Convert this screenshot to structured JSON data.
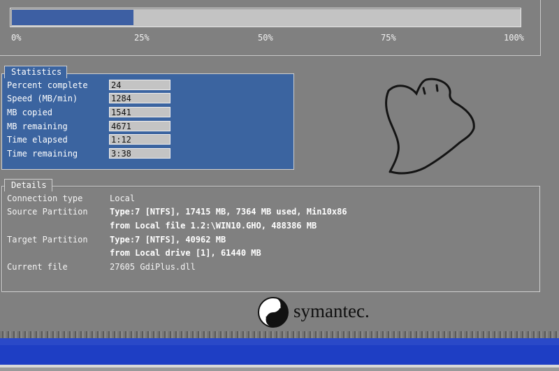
{
  "progress": {
    "fraction": 0.24,
    "ticks": [
      "0%",
      "25%",
      "50%",
      "75%",
      "100%"
    ]
  },
  "statistics": {
    "title": "Statistics",
    "rows": [
      {
        "label": "Percent complete",
        "value": "24"
      },
      {
        "label": "Speed (MB/min)",
        "value": "1284"
      },
      {
        "label": "MB copied",
        "value": "1541"
      },
      {
        "label": "MB remaining",
        "value": "4671"
      },
      {
        "label": "Time elapsed",
        "value": "1:12"
      },
      {
        "label": "Time remaining",
        "value": "3:38"
      }
    ]
  },
  "details": {
    "title": "Details",
    "connection_type_label": "Connection type",
    "connection_type_value": "Local",
    "source_partition_label": "Source Partition",
    "source_partition_line1": "Type:7 [NTFS], 17415 MB, 7364 MB used, Min10x86",
    "source_partition_line2": "from Local file 1.2:\\WIN10.GHO, 488386 MB",
    "target_partition_label": "Target Partition",
    "target_partition_line1": "Type:7 [NTFS], 40962 MB",
    "target_partition_line2": "from Local drive [1], 61440 MB",
    "current_file_label": "Current file",
    "current_file_value": "27605 GdiPlus.dll"
  },
  "branding": {
    "logo_text": "symantec."
  },
  "icons": [
    "ghost-icon",
    "symantec-logo-icon"
  ],
  "colors": {
    "background": "#808080",
    "stats_panel": "#3b64a0",
    "progress_fill": "#3d5fa3",
    "bottom_band": "#1e3ec4"
  }
}
